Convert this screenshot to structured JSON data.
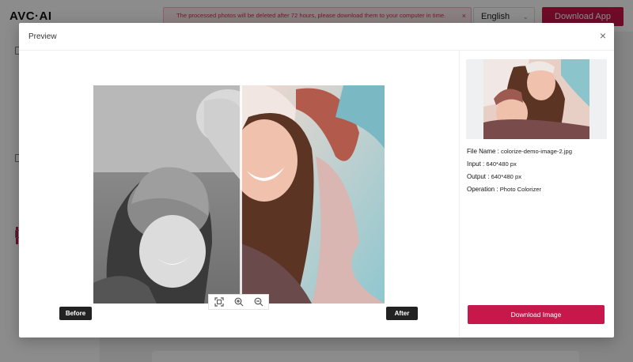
{
  "app": {
    "logo": "AVC·AI",
    "notice": "The processed photos will be deleted after 72 hours, please download them to your computer in time.",
    "notice_close": "×",
    "language": "English",
    "download_app": "Download App"
  },
  "modal": {
    "title": "Preview",
    "close": "×",
    "before_label": "Before",
    "after_label": "After",
    "tools": [
      "fit-screen-icon",
      "zoom-in-icon",
      "zoom-out-icon"
    ],
    "info": {
      "file_name_label": "File Name :",
      "file_name": "colorize-demo-image-2.jpg",
      "input_label": "Input :",
      "input": "640*480 px",
      "output_label": "Output :",
      "output": "640*480 px",
      "operation_label": "Operation :",
      "operation": "Photo Colorizer"
    },
    "download_image": "Download Image"
  },
  "colors": {
    "accent": "#c8174a",
    "notice_bg": "#fde8ec",
    "tag_bg": "#222222"
  }
}
